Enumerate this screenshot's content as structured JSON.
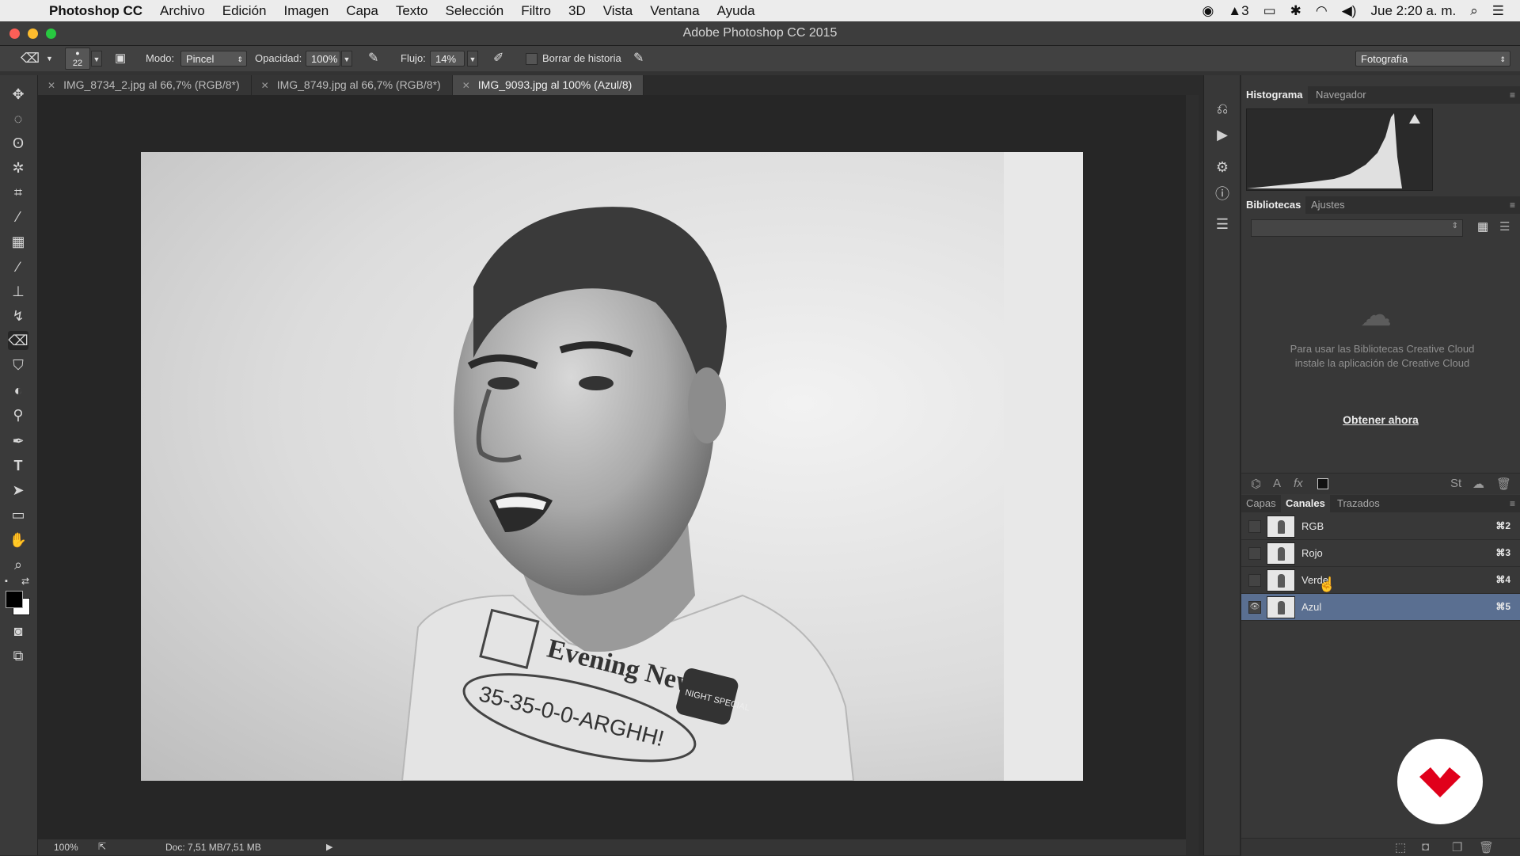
{
  "menubar": {
    "app_name": "Photoshop CC",
    "items": [
      "Archivo",
      "Edición",
      "Imagen",
      "Capa",
      "Texto",
      "Selección",
      "Filtro",
      "3D",
      "Vista",
      "Ventana",
      "Ayuda"
    ],
    "status_count": "3",
    "clock": "Jue 2:20 a. m."
  },
  "window": {
    "title": "Adobe Photoshop CC 2015"
  },
  "options_bar": {
    "brush_size": "22",
    "mode_label": "Modo:",
    "mode_value": "Pincel",
    "opacity_label": "Opacidad:",
    "opacity_value": "100%",
    "flow_label": "Flujo:",
    "flow_value": "14%",
    "history_label": "Borrar de historia",
    "workspace": "Fotografía"
  },
  "tabs": [
    {
      "label": "IMG_8734_2.jpg al 66,7% (RGB/8*)",
      "active": false
    },
    {
      "label": "IMG_8749.jpg al 66,7% (RGB/8*)",
      "active": false
    },
    {
      "label": "IMG_9093.jpg al 100% (Azul/8)",
      "active": true
    }
  ],
  "canvas": {
    "shirt_text": "Evening News",
    "shirt_speech": "35-35-0-0-ARGHH!",
    "shirt_badge": "NIGHT SPECIAL"
  },
  "status": {
    "zoom": "100%",
    "doc": "Doc: 7,51 MB/7,51 MB"
  },
  "panels": {
    "histogram_tabs": [
      "Histograma",
      "Navegador"
    ],
    "libraries_tabs": [
      "Bibliotecas",
      "Ajustes"
    ],
    "libraries_message": "Para usar las Bibliotecas Creative Cloud instale la aplicación de Creative Cloud",
    "libraries_link": "Obtener ahora",
    "layers_tabs": [
      "Capas",
      "Canales",
      "Trazados"
    ],
    "channels": [
      {
        "name": "RGB",
        "shortcut": "⌘2",
        "visible": false,
        "selected": false
      },
      {
        "name": "Rojo",
        "shortcut": "⌘3",
        "visible": false,
        "selected": false
      },
      {
        "name": "Verde",
        "shortcut": "⌘4",
        "visible": false,
        "selected": false
      },
      {
        "name": "Azul",
        "shortcut": "⌘5",
        "visible": true,
        "selected": true
      }
    ]
  },
  "colors": {
    "accent_selected": "#5a6f91",
    "watermark": "#e0001b"
  }
}
